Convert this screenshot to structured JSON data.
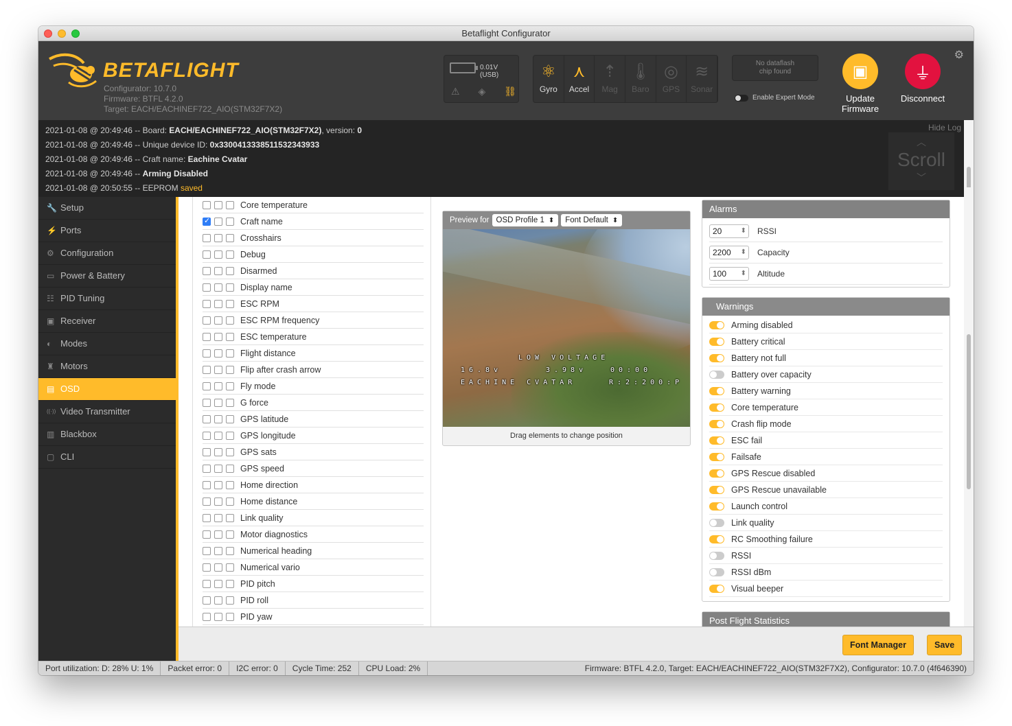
{
  "window": {
    "title": "Betaflight Configurator"
  },
  "header": {
    "logo_text": "BETAFLIGHT",
    "configurator_version": "Configurator: 10.7.0",
    "firmware": "Firmware: BTFL 4.2.0",
    "target": "Target: EACH/EACHINEF722_AIO(STM32F7X2)",
    "battery_text": "0.01V (USB)",
    "sensors": [
      {
        "label": "Gyro",
        "icon": "gyro-icon",
        "active": true
      },
      {
        "label": "Accel",
        "icon": "accel-icon",
        "active": true
      },
      {
        "label": "Mag",
        "icon": "mag-icon",
        "active": false
      },
      {
        "label": "Baro",
        "icon": "baro-icon",
        "active": false
      },
      {
        "label": "GPS",
        "icon": "gps-icon",
        "active": false
      },
      {
        "label": "Sonar",
        "icon": "sonar-icon",
        "active": false
      }
    ],
    "dataflash_line1": "No dataflash",
    "dataflash_line2": "chip found",
    "expert_mode_label": "Enable Expert Mode",
    "update_firmware_line1": "Update",
    "update_firmware_line2": "Firmware",
    "disconnect_label": "Disconnect"
  },
  "log": {
    "hide_label": "Hide Log",
    "scroll_label": "Scroll",
    "lines": [
      {
        "prefix": "2021-01-08 @ 20:49:46 -- Board: ",
        "bold": "EACH/EACHINEF722_AIO(STM32F7X2)",
        "suffix": ", version: ",
        "bold2": "0"
      },
      {
        "prefix": "2021-01-08 @ 20:49:46 -- Unique device ID: ",
        "bold": "0x330041333851153234393​3",
        "suffix": "",
        "bold2": ""
      },
      {
        "prefix": "2021-01-08 @ 20:49:46 -- Craft name: ",
        "bold": "Eachine Cvatar",
        "suffix": "",
        "bold2": ""
      },
      {
        "prefix": "2021-01-08 @ 20:49:46 -- ",
        "bold": "Arming Disabled",
        "suffix": "",
        "bold2": ""
      },
      {
        "prefix": "2021-01-08 @ 20:50:55 -- EEPROM ",
        "bold": "",
        "suffix": "",
        "bold2": "",
        "highlight": "saved"
      }
    ]
  },
  "sidebar": {
    "items": [
      {
        "label": "Setup",
        "icon": "wrench-icon"
      },
      {
        "label": "Ports",
        "icon": "plug-icon"
      },
      {
        "label": "Configuration",
        "icon": "gear-icon"
      },
      {
        "label": "Power & Battery",
        "icon": "battery-icon"
      },
      {
        "label": "PID Tuning",
        "icon": "sliders-icon"
      },
      {
        "label": "Receiver",
        "icon": "receiver-icon"
      },
      {
        "label": "Modes",
        "icon": "toggle-icon"
      },
      {
        "label": "Motors",
        "icon": "motor-icon"
      },
      {
        "label": "OSD",
        "icon": "osd-icon",
        "active": true
      },
      {
        "label": "Video Transmitter",
        "icon": "antenna-icon"
      },
      {
        "label": "Blackbox",
        "icon": "blackbox-icon"
      },
      {
        "label": "CLI",
        "icon": "terminal-icon"
      }
    ]
  },
  "osd_elements": [
    {
      "name": "Core temperature",
      "checked": false
    },
    {
      "name": "Craft name",
      "checked": true
    },
    {
      "name": "Crosshairs",
      "checked": false
    },
    {
      "name": "Debug",
      "checked": false
    },
    {
      "name": "Disarmed",
      "checked": false
    },
    {
      "name": "Display name",
      "checked": false
    },
    {
      "name": "ESC RPM",
      "checked": false
    },
    {
      "name": "ESC RPM frequency",
      "checked": false
    },
    {
      "name": "ESC temperature",
      "checked": false
    },
    {
      "name": "Flight distance",
      "checked": false
    },
    {
      "name": "Flip after crash arrow",
      "checked": false
    },
    {
      "name": "Fly mode",
      "checked": false
    },
    {
      "name": "G force",
      "checked": false
    },
    {
      "name": "GPS latitude",
      "checked": false
    },
    {
      "name": "GPS longitude",
      "checked": false
    },
    {
      "name": "GPS sats",
      "checked": false
    },
    {
      "name": "GPS speed",
      "checked": false
    },
    {
      "name": "Home direction",
      "checked": false
    },
    {
      "name": "Home distance",
      "checked": false
    },
    {
      "name": "Link quality",
      "checked": false
    },
    {
      "name": "Motor diagnostics",
      "checked": false
    },
    {
      "name": "Numerical heading",
      "checked": false
    },
    {
      "name": "Numerical vario",
      "checked": false
    },
    {
      "name": "PID pitch",
      "checked": false
    },
    {
      "name": "PID roll",
      "checked": false
    },
    {
      "name": "PID yaw",
      "checked": false
    }
  ],
  "preview": {
    "preview_for_label": "Preview for",
    "profile_select": "OSD Profile 1",
    "font_select": "Font Default",
    "footer": "Drag elements to change position",
    "osd_line1": "LOW VOLTAGE",
    "osd_batt1": "16.8v",
    "osd_batt2": "3.98v",
    "osd_timer": "00:00",
    "osd_craft": "EACHINE CVATAR",
    "osd_rate": "R:2:200:P"
  },
  "alarms": {
    "title": "Alarms",
    "items": [
      {
        "value": "20",
        "label": "RSSI"
      },
      {
        "value": "2200",
        "label": "Capacity"
      },
      {
        "value": "100",
        "label": "Altitude"
      }
    ]
  },
  "warnings": {
    "title": "Warnings",
    "items": [
      {
        "label": "Arming disabled",
        "on": true
      },
      {
        "label": "Battery critical",
        "on": true
      },
      {
        "label": "Battery not full",
        "on": true
      },
      {
        "label": "Battery over capacity",
        "on": false
      },
      {
        "label": "Battery warning",
        "on": true
      },
      {
        "label": "Core temperature",
        "on": true
      },
      {
        "label": "Crash flip mode",
        "on": true
      },
      {
        "label": "ESC fail",
        "on": true
      },
      {
        "label": "Failsafe",
        "on": true
      },
      {
        "label": "GPS Rescue disabled",
        "on": true
      },
      {
        "label": "GPS Rescue unavailable",
        "on": true
      },
      {
        "label": "Launch control",
        "on": true
      },
      {
        "label": "Link quality",
        "on": false
      },
      {
        "label": "RC Smoothing failure",
        "on": true
      },
      {
        "label": "RSSI",
        "on": false
      },
      {
        "label": "RSSI dBm",
        "on": false
      },
      {
        "label": "Visual beeper",
        "on": true
      }
    ]
  },
  "post_flight": {
    "title": "Post Flight Statistics"
  },
  "buttons": {
    "font_manager": "Font Manager",
    "save": "Save"
  },
  "status": {
    "port_util": "Port utilization: D: 28% U: 1%",
    "packet_error": "Packet error: 0",
    "i2c_error": "I2C error: 0",
    "cycle_time": "Cycle Time: 252",
    "cpu_load": "CPU Load: 2%",
    "firmware_info": "Firmware: BTFL 4.2.0, Target: EACH/EACHINEF722_AIO(STM32F7X2), Configurator: 10.7.0 (4f646390)"
  },
  "colors": {
    "accent": "#ffbb2a",
    "disconnect": "#e2123f",
    "header_bg": "#3d3d3d"
  }
}
